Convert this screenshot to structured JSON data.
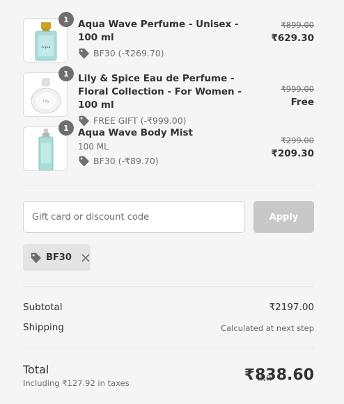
{
  "items": [
    {
      "quantity": "1",
      "name": "Aqua Wave Perfume - Unisex - 100 ml",
      "variant": "",
      "discount": "BF30 (-₹269.70)",
      "original_price": "₹899.00",
      "final_price": "₹629.30",
      "image": "aqua-wave-perfume-bottle"
    },
    {
      "quantity": "1",
      "name": "Lily & Spice Eau de Perfume - Floral Collection - For Women - 100 ml",
      "variant": "",
      "discount": "FREE GIFT (-₹999.00)",
      "original_price": "₹999.00",
      "final_price": "Free",
      "image": "lily-spice-perfume-bottle"
    },
    {
      "quantity": "1",
      "name": "Aqua Wave Body Mist",
      "variant": "100 ML",
      "discount": "BF30 (-₹89.70)",
      "original_price": "₹299.00",
      "final_price": "₹209.30",
      "image": "aqua-wave-body-mist-bottle"
    }
  ],
  "discount_form": {
    "placeholder": "Gift card or discount code",
    "value": "",
    "apply_label": "Apply",
    "apply_disabled": true
  },
  "applied_codes": [
    "BF30"
  ],
  "summary": {
    "subtotal_label": "Subtotal",
    "subtotal_value": "₹2197.00",
    "shipping_label": "Shipping",
    "shipping_value": "Calculated at next step",
    "total_label": "Total",
    "taxes_note": "Including ₹127.92 in taxes",
    "currency": "INR",
    "total_value": "₹838.60"
  },
  "colors": {
    "background": "#f5f5f5",
    "badge": "#6e6e6e",
    "apply_disabled": "#c8c8c8",
    "chip": "#e4e4e4"
  },
  "icons": {
    "discount_tag": "tag-icon",
    "remove_code": "close-icon"
  }
}
